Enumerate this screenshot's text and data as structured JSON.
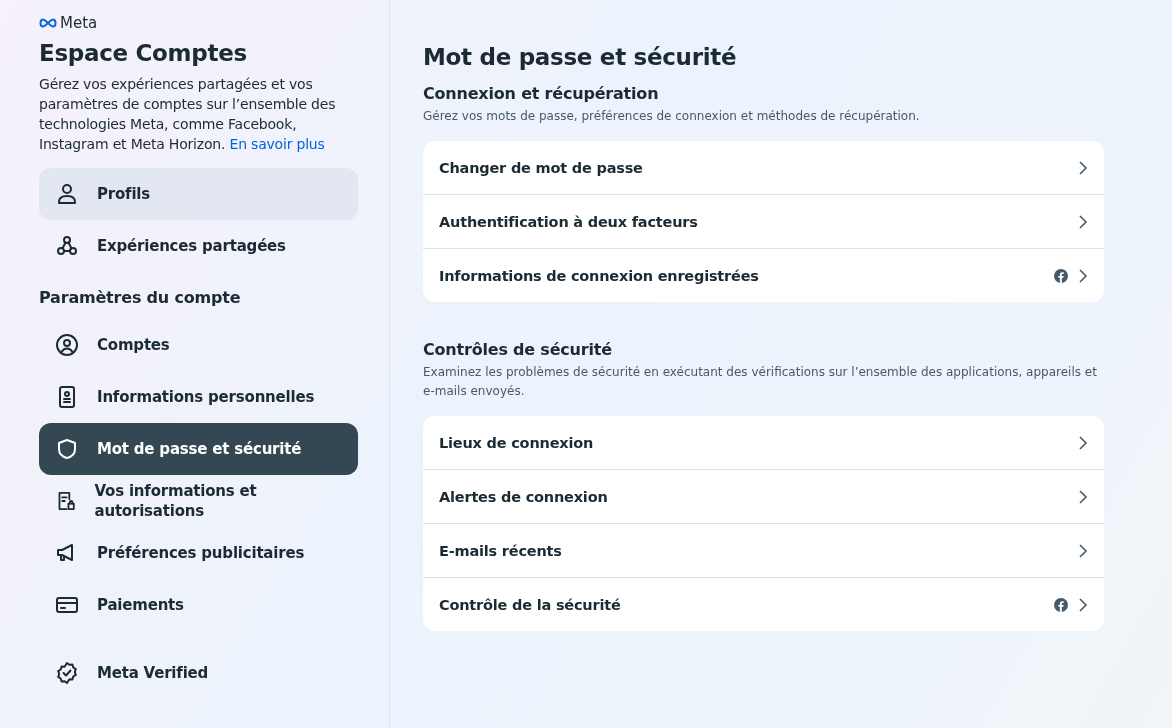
{
  "sidebar": {
    "brand": "Meta",
    "title": "Espace Comptes",
    "description": "Gérez vos expériences partagées et vos paramètres de comptes sur l’ensemble des technologies Meta, comme Facebook, Instagram et Meta Horizon.",
    "learn_more": "En savoir plus",
    "top_items": [
      {
        "label": "Profils",
        "selected": false,
        "hovered": true
      },
      {
        "label": "Expériences partagées",
        "selected": false,
        "hovered": false
      }
    ],
    "section_title": "Paramètres du compte",
    "items": [
      {
        "label": "Comptes",
        "selected": false,
        "hovered": false
      },
      {
        "label": "Informations personnelles",
        "selected": false,
        "hovered": false
      },
      {
        "label": "Mot de passe et sécurité",
        "selected": true,
        "hovered": false
      },
      {
        "label": "Vos informations et autorisations",
        "selected": false,
        "hovered": false
      },
      {
        "label": "Préférences publicitaires",
        "selected": false,
        "hovered": false
      },
      {
        "label": "Paiements",
        "selected": false,
        "hovered": false
      }
    ],
    "bottom_items": [
      {
        "label": "Meta Verified",
        "selected": false,
        "hovered": false
      }
    ]
  },
  "main": {
    "title": "Mot de passe et sécurité",
    "sections": [
      {
        "title": "Connexion et récupération",
        "description": "Gérez vos mots de passe, préférences de connexion et méthodes de récupération.",
        "rows": [
          {
            "label": "Changer de mot de passe",
            "facebook": false
          },
          {
            "label": "Authentification à deux facteurs",
            "facebook": false
          },
          {
            "label": "Informations de connexion enregistrées",
            "facebook": true
          }
        ]
      },
      {
        "title": "Contrôles de sécurité",
        "description": "Examinez les problèmes de sécurité en exécutant des vérifications sur l’ensemble des applications, appareils et e-mails envoyés.",
        "rows": [
          {
            "label": "Lieux de connexion",
            "facebook": false
          },
          {
            "label": "Alertes de connexion",
            "facebook": false
          },
          {
            "label": "E-mails récents",
            "facebook": false
          },
          {
            "label": "Contrôle de la sécurité",
            "facebook": true
          }
        ]
      }
    ]
  }
}
